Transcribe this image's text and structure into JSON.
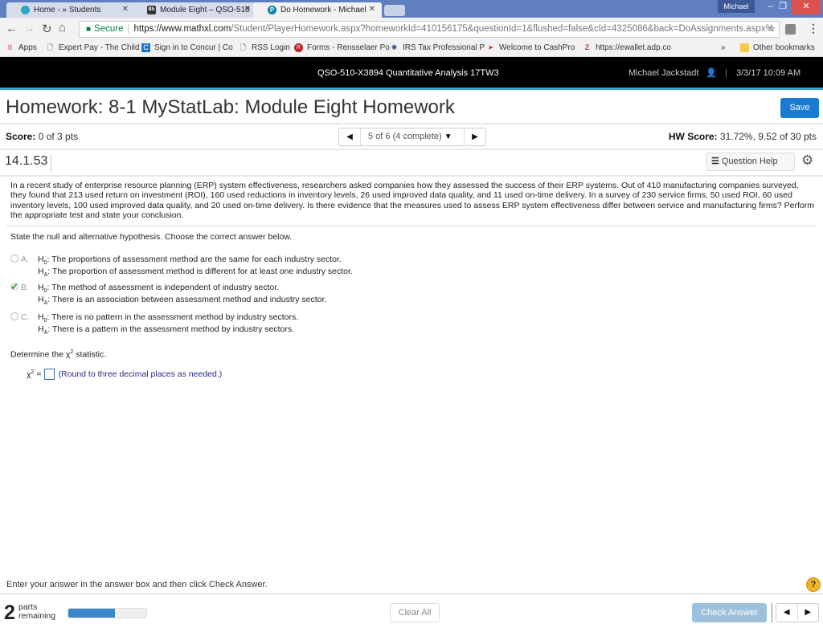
{
  "browser": {
    "tabs": [
      {
        "title": "Home - » Students",
        "icon": "globe-icon",
        "active": false
      },
      {
        "title": "Module Eight – QSO-510",
        "icon": "blackboard-icon",
        "active": false
      },
      {
        "title": "Do Homework - Michael",
        "icon": "pearson-icon",
        "active": true
      }
    ],
    "profile_name": "Michael",
    "security_label": "Secure",
    "url_host": "https://www.mathxl.com",
    "url_path": "/Student/PlayerHomework.aspx?homeworkId=410156175&questionId=1&flushed=false&cId=4325086&back=DoAssignments.aspx%",
    "bookmarks": [
      {
        "label": "Apps",
        "icon": "apps-grid-icon"
      },
      {
        "label": "Expert Pay - The Child",
        "icon": "page-icon"
      },
      {
        "label": "Sign in to Concur | Co",
        "icon": "concur-icon"
      },
      {
        "label": "RSS Login",
        "icon": "page-icon"
      },
      {
        "label": "Forms - Rensselaer Po",
        "icon": "rensselaer-icon"
      },
      {
        "label": "IRS Tax Professional P",
        "icon": "irs-icon"
      },
      {
        "label": "Welcome to CashPro",
        "icon": "bofa-icon"
      },
      {
        "label": "https://ewallet.adp.co",
        "icon": "adp-icon"
      }
    ],
    "overflow_label": "»",
    "other_bookmarks": "Other bookmarks"
  },
  "site_header": {
    "course": "QSO-510-X3894 Quantitative Analysis 17TW3",
    "user": "Michael Jackstadt",
    "separator": "|",
    "datetime": "3/3/17 10:09 AM"
  },
  "homework": {
    "title": "Homework: 8-1 MyStatLab: Module Eight Homework",
    "save_label": "Save",
    "score_label": "Score:",
    "score_value": "0 of 3 pts",
    "question_nav": "5 of 6 (4 complete)",
    "hw_score_label": "HW Score:",
    "hw_score_value": "31.72%, 9.52 of 30 pts",
    "question_number": "14.1.53",
    "question_help_label": "Question Help"
  },
  "question": {
    "prompt": "In a recent study of enterprise resource planning (ERP) system effectiveness, researchers asked companies how they assessed the success of their ERP systems. Out of 410 manufacturing companies surveyed, they found that 213 used return on investment (ROI), 160 used reductions in inventory levels, 26 used improved data quality, and 11 used on-time delivery. In a survey of 230 service firms, 50 used ROI, 60 used inventory levels, 100 used improved data quality, and 20 used on-time delivery. Is there evidence that the measures used to assess ERP system effectiveness differ between service and manufacturing firms? Perform the appropriate test and state your conclusion.",
    "instruction": "State the null and alternative hypothesis. Choose the correct answer below.",
    "options": [
      {
        "letter": "A.",
        "h0": "The proportions of assessment method are the same for each industry sector.",
        "ha": "The proportion of assessment method is different for at least one industry sector.",
        "selected": false
      },
      {
        "letter": "B.",
        "h0": "The method of assessment is independent of industry sector.",
        "ha": "There is an association between assessment method and industry sector.",
        "selected": true
      },
      {
        "letter": "C.",
        "h0": "There is no pattern in the assessment method by industry sectors.",
        "ha": "There is a pattern in the assessment method by industry sectors.",
        "selected": false
      }
    ],
    "h0_label": "H",
    "h0_sub": "0",
    "ha_label": "H",
    "ha_sub": "A",
    "determine_prefix": "Determine the ",
    "chi_symbol": "χ",
    "chi_exp": "2",
    "determine_suffix": " statistic.",
    "equals": "=",
    "answer_value": "",
    "round_hint": "(Round to three decimal places as needed.)"
  },
  "footer": {
    "instruction": "Enter your answer in the answer box and then click Check Answer.",
    "help_label": "?",
    "parts_remaining_count": "2",
    "parts_label": "parts",
    "remaining_label": "remaining",
    "progress_fraction": 0.6,
    "clear_all_label": "Clear All",
    "check_answer_label": "Check Answer"
  }
}
